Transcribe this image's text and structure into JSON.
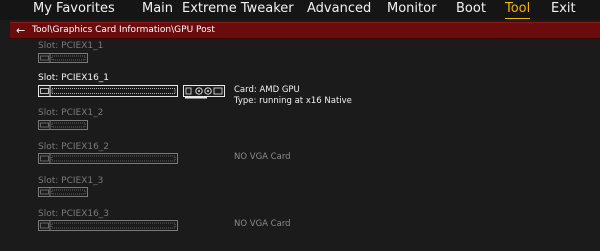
{
  "menu": {
    "items": [
      {
        "label": "My Favorites",
        "active": false
      },
      {
        "label": "Main",
        "active": false
      },
      {
        "label": "Extreme Tweaker",
        "active": false
      },
      {
        "label": "Advanced",
        "active": false
      },
      {
        "label": "Monitor",
        "active": false
      },
      {
        "label": "Boot",
        "active": false
      },
      {
        "label": "Tool",
        "active": true
      },
      {
        "label": "Exit",
        "active": false
      }
    ]
  },
  "breadcrumb": {
    "back_icon": "arrow-left-icon",
    "path": "Tool\\Graphics Card Information\\GPU Post"
  },
  "slots": [
    {
      "label": "Slot: PCIEX1_1",
      "size": "x1",
      "occupied": false
    },
    {
      "label": "Slot: PCIEX16_1",
      "size": "x16",
      "occupied": true,
      "card": "Card: AMD GPU",
      "type": "Type: running at x16 Native"
    },
    {
      "label": "Slot: PCIEX1_2",
      "size": "x1",
      "occupied": false
    },
    {
      "label": "Slot: PCIEX16_2",
      "size": "x16",
      "occupied": false,
      "status": "NO VGA Card"
    },
    {
      "label": "Slot: PCIEX1_3",
      "size": "x1",
      "occupied": false
    },
    {
      "label": "Slot: PCIEX16_3",
      "size": "x16",
      "occupied": false,
      "status": "NO VGA Card"
    }
  ],
  "colors": {
    "accent": "#f5b700",
    "breadcrumb_bg": "#6b0c0c",
    "background": "#1b1b1b",
    "slot_empty": "#7a7a7a",
    "slot_filled": "#f5f5f5"
  }
}
